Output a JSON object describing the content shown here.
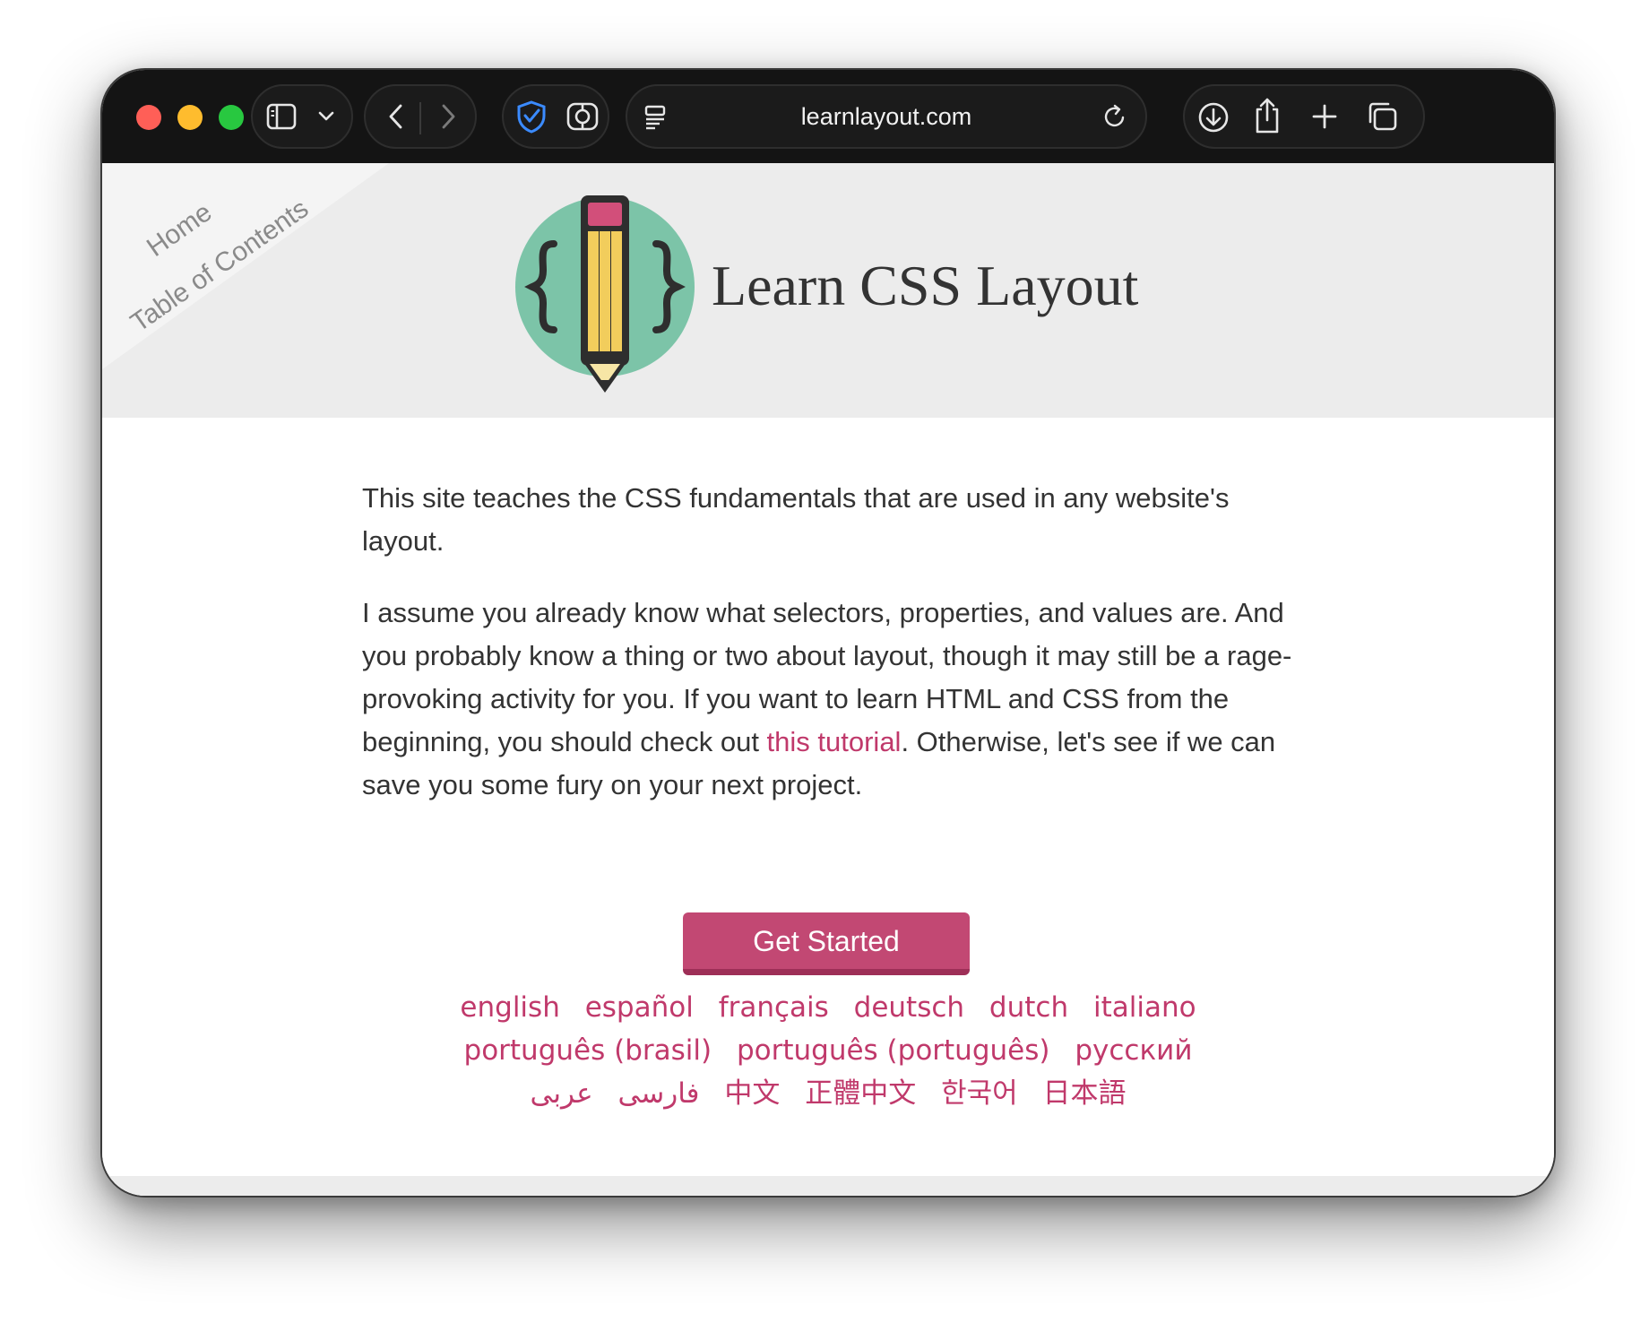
{
  "browser": {
    "url": "learnlayout.com"
  },
  "nav": {
    "home": "Home",
    "toc": "Table of Contents"
  },
  "header": {
    "title": "Learn CSS Layout"
  },
  "content": {
    "p1": "This site teaches the CSS fundamentals that are used in any website's layout.",
    "p2_before": "I assume you already know what selectors, properties, and values are. And you probably know a thing or two about layout, though it may still be a rage-provoking activity for you. If you want to learn HTML and CSS from the beginning, you should check out ",
    "p2_link": "this tutorial",
    "p2_after": ". Otherwise, let's see if we can save you some fury on your next project."
  },
  "cta": {
    "label": "Get Started"
  },
  "languages": {
    "row1": [
      "english",
      "español",
      "français",
      "deutsch",
      "dutch",
      "italiano"
    ],
    "row2": [
      "português (brasil)",
      "português (português)",
      "русский"
    ],
    "row3": [
      "عربى",
      "فارسی",
      "中文",
      "正體中文",
      "한국어",
      "日本語"
    ]
  },
  "colors": {
    "accent": "#c0396b",
    "button": "#c24873",
    "header_bg": "#ececec",
    "toolbar_bg": "#141414",
    "logo_circle": "#7cc4a8"
  }
}
